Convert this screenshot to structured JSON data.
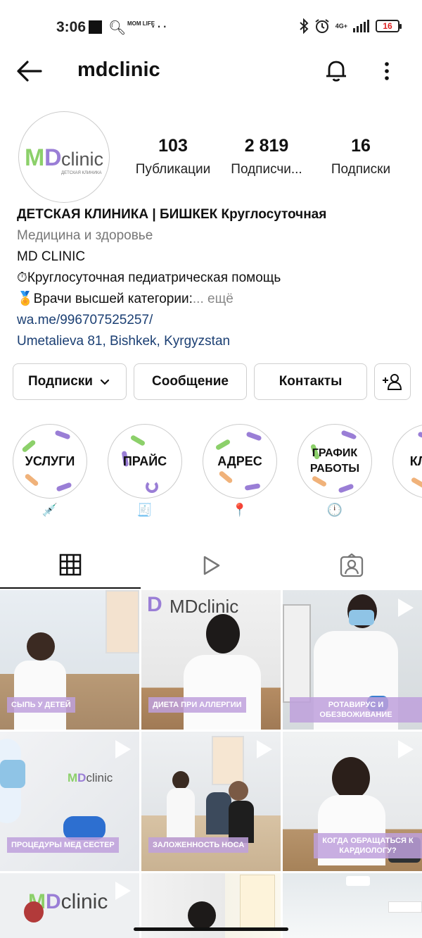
{
  "status_bar": {
    "time": "3:06",
    "app_icon_text": "MOM LIFE",
    "battery": "16",
    "network": "4G+"
  },
  "header": {
    "title": "mdclinic"
  },
  "profile": {
    "avatar_logo": "MDclinic",
    "avatar_sub": "детская клиника",
    "stats": [
      {
        "value": "103",
        "label": "Публикации"
      },
      {
        "value": "2 819",
        "label": "Подписчи..."
      },
      {
        "value": "16",
        "label": "Подписки"
      }
    ],
    "bio": {
      "name": "ДЕТСКАЯ КЛИНИКА | БИШКЕК Круглосуточная",
      "category": "Медицина и здоровье",
      "line1": "MD CLINIC",
      "line2": "⏱Круглосуточная педиатрическая помощь",
      "line3": "🏅Врачи высшей категории:",
      "more": "... ещё",
      "link": "wa.me/996707525257/",
      "address": "Umetalieva 81, Bishkek, Kyrgyzstan"
    }
  },
  "buttons": {
    "following": "Подписки",
    "message": "Сообщение",
    "contacts": "Контакты"
  },
  "highlights": [
    {
      "label": "УСЛУГИ",
      "emoji": "💉"
    },
    {
      "label": "ПРАЙС",
      "emoji": "🧾"
    },
    {
      "label": "АДРЕС",
      "emoji": "📍"
    },
    {
      "label": "ГРАФИК РАБОТЫ",
      "emoji": "🕛"
    },
    {
      "label": "КЛИ",
      "emoji": ""
    }
  ],
  "posts": [
    {
      "label": "СЫПЬ У ДЕТЕЙ",
      "video": false
    },
    {
      "label": "ДИЕТА ПРИ АЛЛЕРГИИ",
      "video": false
    },
    {
      "label": "РОТАВИРУС И ОБЕЗВОЖИВАНИЕ",
      "video": true
    },
    {
      "label": "ПРОЦЕДУРЫ МЕД СЕСТЕР",
      "video": true
    },
    {
      "label": "ЗАЛОЖЕННОСТЬ НОСА",
      "video": true
    },
    {
      "label": "КОГДА ОБРАЩАТЬСЯ К КАРДИОЛОГУ?",
      "video": true
    },
    {
      "label": "",
      "video": true
    },
    {
      "label": "",
      "video": false
    },
    {
      "label": "",
      "video": false
    }
  ],
  "post_watermark": "MDclinic",
  "colors": {
    "link": "#1b3f73",
    "label_bg": "#bea0dc",
    "accent_green": "#8cd06a",
    "accent_purple": "#8e6cc9"
  }
}
